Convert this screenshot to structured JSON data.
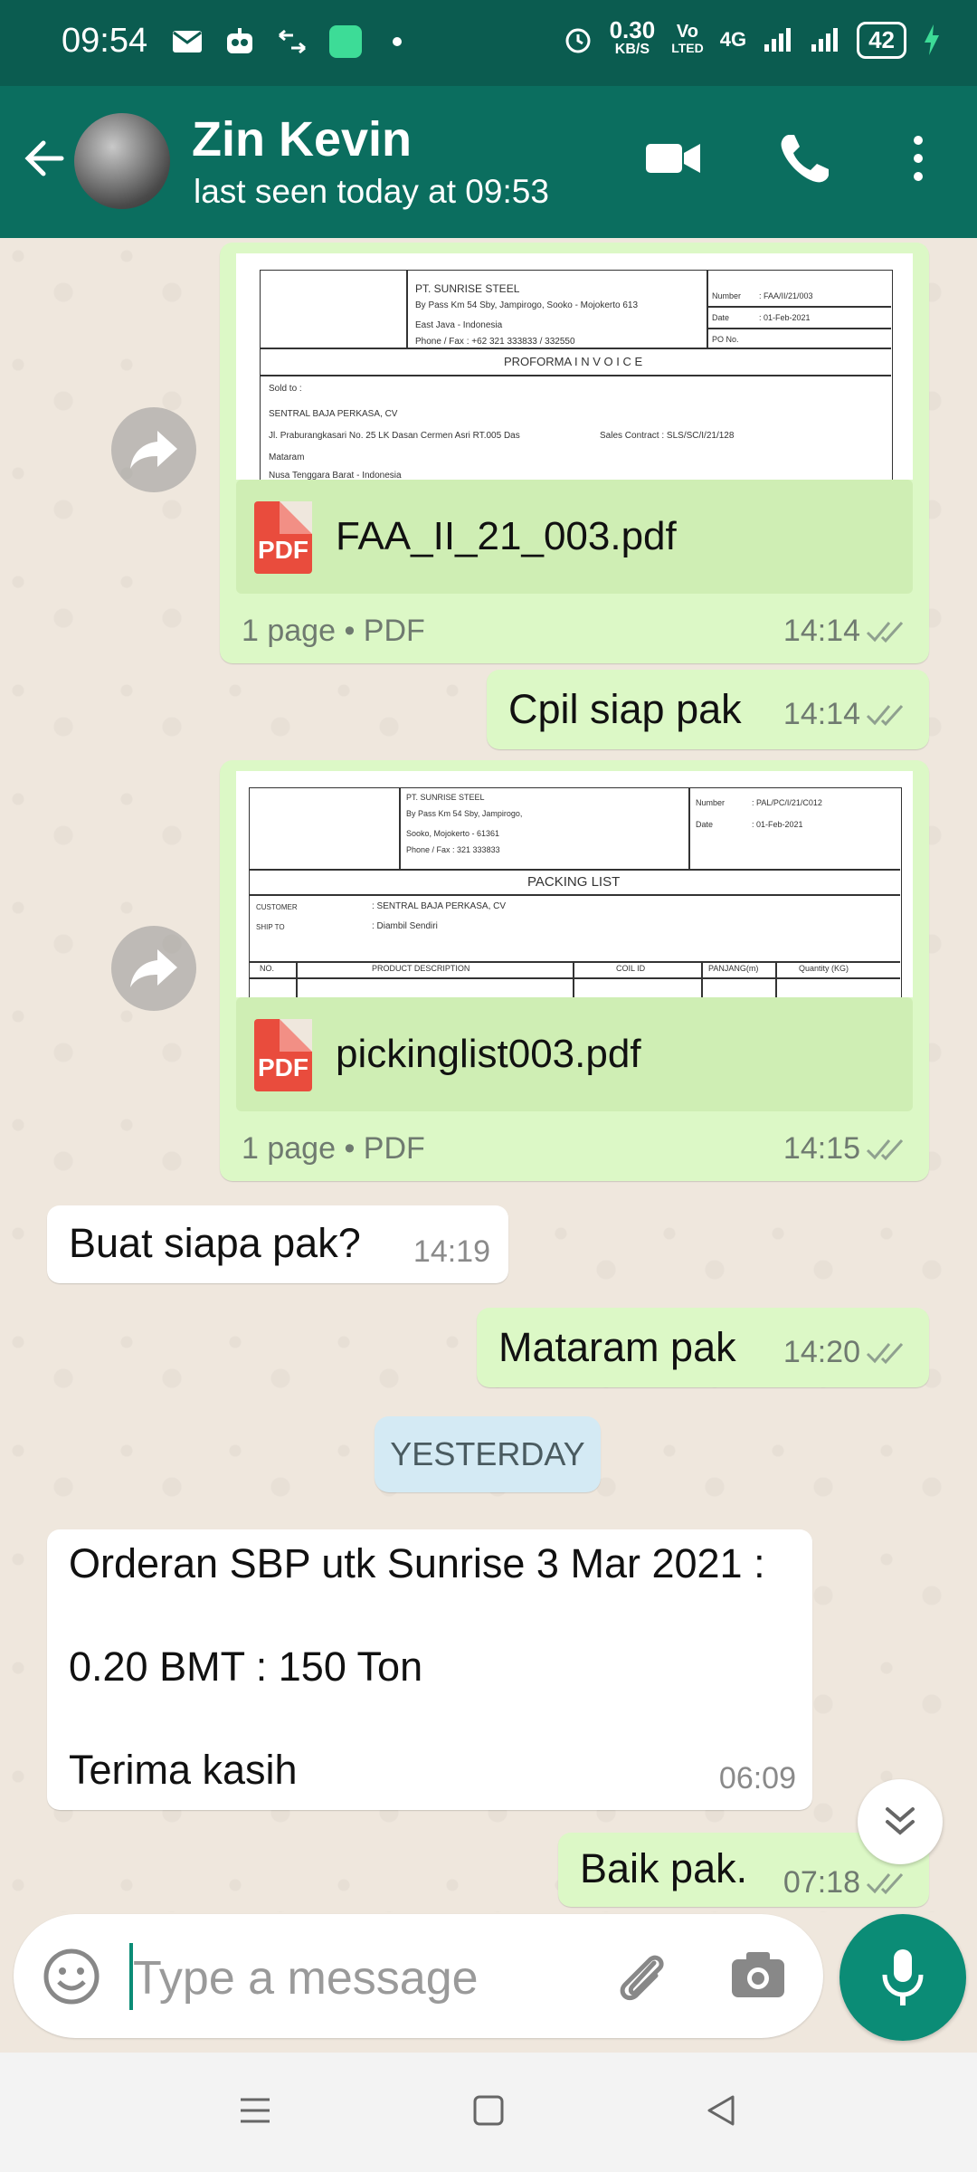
{
  "status_bar": {
    "time": "09:54",
    "net_speed_top": "0.30",
    "net_speed_bottom": "KB/S",
    "volte_top": "Vo",
    "volte_bottom": "LTED",
    "network": "4G",
    "battery": "42"
  },
  "header": {
    "contact_name": "Zin Kevin",
    "last_seen": "last seen today at 09:53"
  },
  "messages": {
    "doc1": {
      "preview": {
        "company": "PT. SUNRISE STEEL",
        "address": "By Pass Km 54 Sby, Jampirogo, Sooko - Mojokerto 613",
        "region": "East Java - Indonesia",
        "phone": "Phone / Fax :        +62 321 333833 / 332550",
        "number_label": "Number",
        "number_value": ":   FAA/II/21/003",
        "date_label": "Date",
        "date_value": ":   01-Feb-2021",
        "po_label": "PO No.",
        "doc_title": "PROFORMA   I N V O I C E",
        "sold_to": "Sold to :",
        "customer": "SENTRAL BAJA PERKASA, CV",
        "cust_address": "Jl. Praburangkasari No. 25 LK Dasan Cermen Asri RT.005 Das",
        "sales_contract": "Sales Contract :      SLS/SC/I/21/128",
        "city": "Mataram",
        "province": "Nusa Tenggara Barat - Indonesia"
      },
      "pdf_label": "PDF",
      "file_name": "FAA_II_21_003.pdf",
      "file_meta": "1 page • PDF",
      "time": "14:14"
    },
    "msg1": {
      "text": "Cpil siap pak",
      "time": "14:14"
    },
    "doc2": {
      "preview": {
        "company": "PT. SUNRISE STEEL",
        "address": "By Pass Km 54 Sby, Jampirogo,",
        "city": "Sooko, Mojokerto - 61361",
        "phone": "Phone / Fax :     321 333833",
        "number_label": "Number",
        "number_value": ":   PAL/PC/I/21/C012",
        "date_label": "Date",
        "date_value": ":   01-Feb-2021",
        "doc_title": "PACKING LIST",
        "customer_label": "CUSTOMER",
        "customer_value": ":    SENTRAL BAJA PERKASA, CV",
        "ship_label": "SHIP TO",
        "ship_value": ":    Diambil Sendiri",
        "col_no": "NO.",
        "col_desc": "PRODUCT DESCRIPTION",
        "col_coil": "COIL ID",
        "col_len": "PANJANG(m)",
        "col_qty": "Quantity (KG)"
      },
      "pdf_label": "PDF",
      "file_name": "pickinglist003.pdf",
      "file_meta": "1 page • PDF",
      "time": "14:15"
    },
    "msg2": {
      "text": "Buat siapa pak?",
      "time": "14:19"
    },
    "msg3": {
      "text": "Mataram pak",
      "time": "14:20"
    },
    "date_divider": "YESTERDAY",
    "msg4": {
      "line1": "Orderan SBP utk Sunrise 3 Mar 2021 :",
      "line2": "0.20 BMT : 150 Ton",
      "line3": "Terima kasih",
      "time": "06:09"
    },
    "msg5": {
      "text": "Baik pak.",
      "time": "07:18"
    }
  },
  "composer": {
    "placeholder": "Type a message"
  },
  "colors": {
    "header": "#0b6e5f",
    "status_bar": "#0b5c50",
    "outgoing_bubble": "#dcf8c6",
    "incoming_bubble": "#ffffff",
    "accent": "#0b8c76",
    "read_ticks": "#8fa08f"
  },
  "icons": [
    "mail-icon",
    "bot-icon",
    "arrows-icon",
    "app-icon",
    "alarm-icon",
    "signal-icon",
    "charging-icon",
    "back-arrow-icon",
    "video-call-icon",
    "phone-icon",
    "more-icon",
    "forward-icon",
    "pdf-icon",
    "double-check-icon",
    "chevrons-down-icon",
    "emoji-icon",
    "attach-icon",
    "camera-icon",
    "mic-icon",
    "menu-icon",
    "home-icon",
    "back-nav-icon"
  ]
}
